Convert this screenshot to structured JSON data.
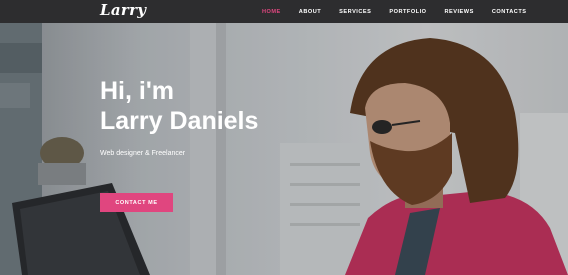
{
  "header": {
    "logo": "Larry",
    "menu": [
      {
        "label": "HOME",
        "active": true
      },
      {
        "label": "ABOUT",
        "active": false
      },
      {
        "label": "SERVICES",
        "active": false
      },
      {
        "label": "PORTFOLIO",
        "active": false
      },
      {
        "label": "REVIEWS",
        "active": false
      },
      {
        "label": "CONTACTS",
        "active": false
      }
    ]
  },
  "hero": {
    "greeting": "Hi, i'm",
    "name": "Larry Daniels",
    "subtitle": "Web designer & Freelancer",
    "cta_label": "CONTACT ME"
  },
  "colors": {
    "accent": "#e0467f",
    "nav_bg": "#2d2d2f",
    "jacket": "#c2345f"
  }
}
